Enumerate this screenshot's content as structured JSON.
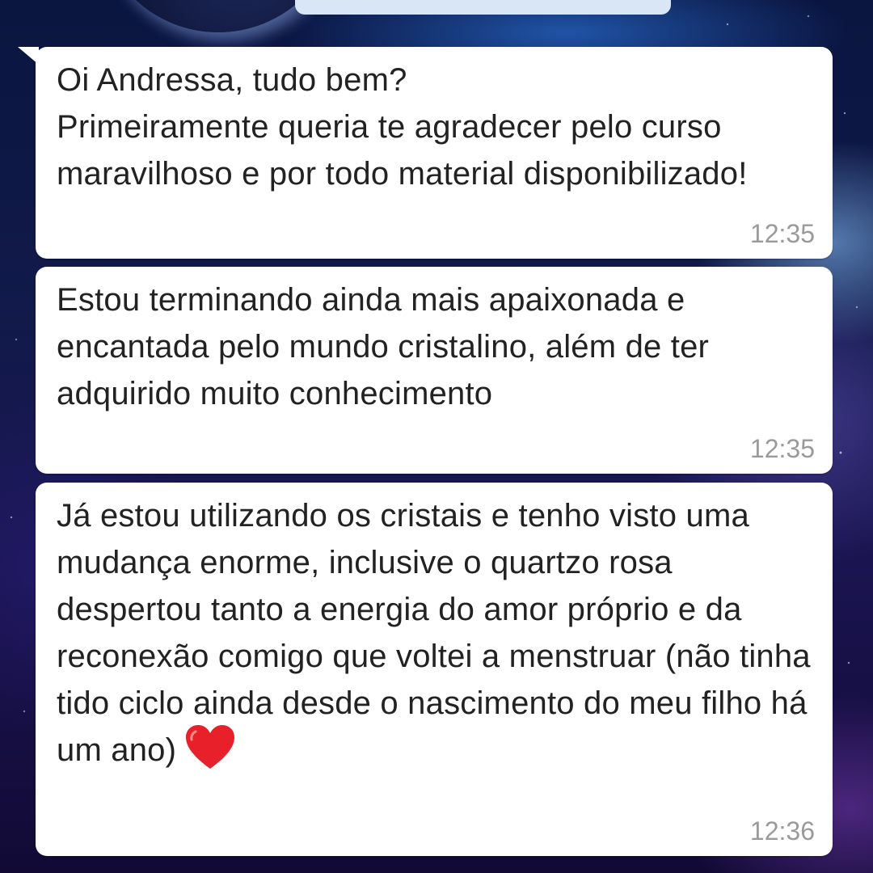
{
  "chat": {
    "messages": [
      {
        "text": "Oi Andressa, tudo bem?\nPrimeiramente queria te agradecer pelo curso maravilhoso e por todo material disponibilizado!",
        "time": "12:35"
      },
      {
        "text": "Estou terminando ainda mais apaixonada e encantada pelo mundo cristalino, além de ter adquirido muito conhecimento",
        "time": "12:35"
      },
      {
        "text": "Já estou utilizando os cristais e tenho visto uma mudança enorme, inclusive o quartzo rosa despertou tanto a energia do amor próprio e da reconexão comigo que voltei a menstruar (não tinha tido ciclo ainda desde o nascimento do meu filho há um ano)",
        "time": "12:36",
        "emoji": "red-heart-icon"
      }
    ]
  },
  "colors": {
    "bubble": "#ffffff",
    "text": "#222222",
    "timestamp": "#9a9a9a",
    "heart": "#e8202a"
  }
}
